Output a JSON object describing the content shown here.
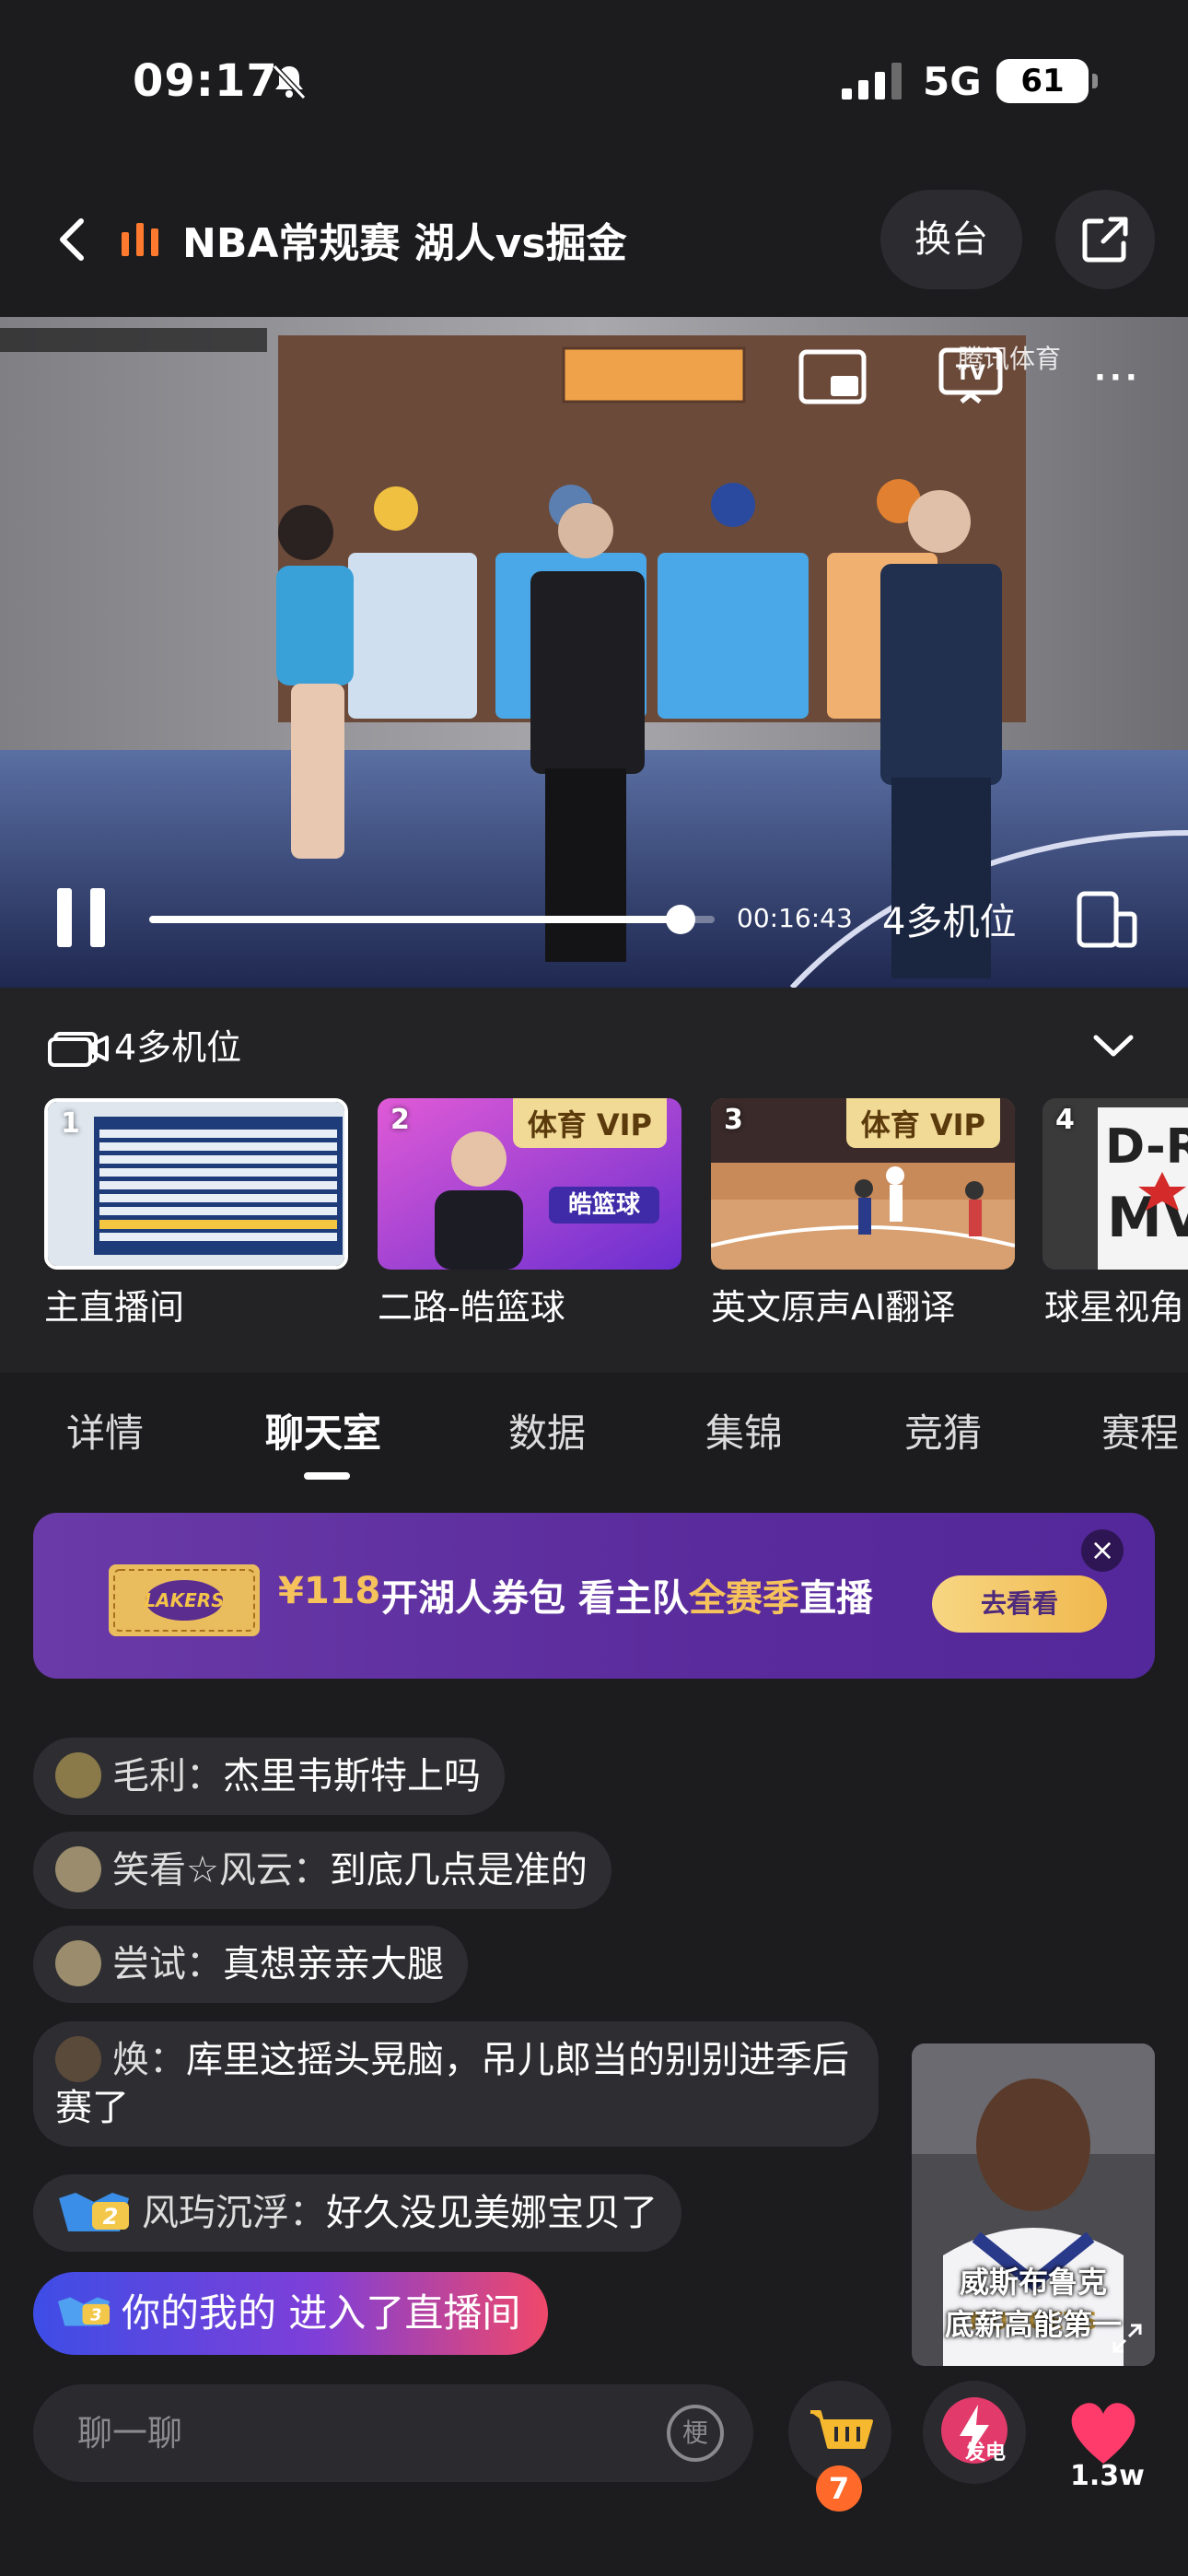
{
  "status_bar": {
    "time": "09:17",
    "network": "5G",
    "battery": "61"
  },
  "header": {
    "title": "NBA常规赛 湖人vs掘金",
    "switch_label": "换台"
  },
  "video": {
    "watermark": "腾讯体育",
    "elapsed": "00:16:43",
    "progress_fraction": 0.94,
    "multi_cam_label": "4多机位",
    "more_icon": "···"
  },
  "cameras": {
    "title": "4多机位",
    "items": [
      {
        "num": "1",
        "name": "主直播间",
        "vip": "",
        "active": true
      },
      {
        "num": "2",
        "name": "二路-皓篮球",
        "vip": "体育 VIP",
        "active": false
      },
      {
        "num": "3",
        "name": "英文原声AI翻译",
        "vip": "体育 VIP",
        "active": false
      },
      {
        "num": "4",
        "name": "球星视角",
        "vip": "",
        "active": false
      }
    ]
  },
  "tabs": [
    {
      "label": "详情",
      "active": false
    },
    {
      "label": "聊天室",
      "active": true
    },
    {
      "label": "数据",
      "active": false
    },
    {
      "label": "集锦",
      "active": false
    },
    {
      "label": "竞猜",
      "active": false
    },
    {
      "label": "赛程",
      "active": false
    }
  ],
  "promo": {
    "price": "¥118",
    "text_a": "开湖人券包 看主队",
    "text_highlight": "全赛季",
    "text_b": "直播",
    "cta": "去看看",
    "close": "×"
  },
  "chat": [
    {
      "user": "毛利",
      "sep": "：",
      "text": "杰里韦斯特上吗"
    },
    {
      "user": "笑看☆风云",
      "sep": "：",
      "text": "到底几点是准的"
    },
    {
      "user": "尝试",
      "sep": "：",
      "text": "真想亲亲大腿"
    },
    {
      "user": "焕",
      "sep": "：",
      "text": "库里这摇头晃脑，吊儿郎当的别别进季后赛了"
    },
    {
      "user": "风玙沉浮",
      "sep": "：",
      "text": "好久没见美娜宝贝了"
    }
  ],
  "enter_notice": {
    "user": "你的我的",
    "text": "进入了直播间"
  },
  "float_ad": {
    "line1": "威斯布鲁克",
    "line2": "底薪高能第一"
  },
  "bottom": {
    "input_placeholder": "聊一聊",
    "meme_label": "梗",
    "cart_count": "7",
    "power_label": "发电",
    "like_count": "1.3w"
  },
  "colors": {
    "accent_orange": "#ff7a2e",
    "promo_purple": "#5a2b9c",
    "promo_gold": "#f6c25b",
    "like_pink": "#ff3b6b"
  }
}
